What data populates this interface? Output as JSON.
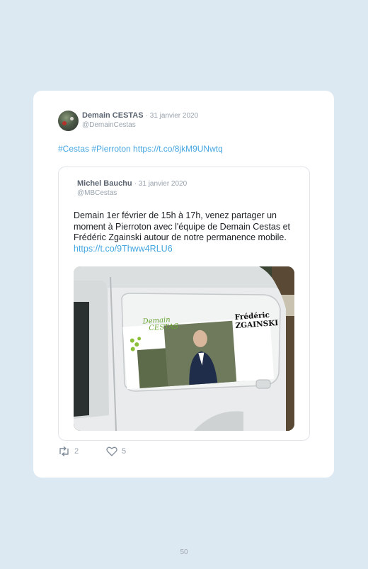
{
  "tweet": {
    "author_name": "Demain CESTAS",
    "date": "· 31 janvier 2020",
    "handle": "@DemainCestas",
    "text": "#Cestas #Pierroton https://t.co/8jkM9UNwtq"
  },
  "quoted": {
    "author_name": "Michel Bauchu",
    "date": "· 31 janvier 2020",
    "handle": "@MBCestas",
    "text": "Demain 1er février de 15h à 17h, venez partager un moment à Pierroton avec l'équipe de Demain Cestas et Frédéric Zgainski autour de notre permanence mobile.",
    "link": "https://t.co/9Thww4RLU6",
    "image_text": {
      "logo_line1": "Demain",
      "logo_line2": "CESTAS",
      "name_line1": "Frédéric",
      "name_line2": "ZGAINSKI"
    }
  },
  "actions": {
    "retweets": "2",
    "likes": "5"
  },
  "page_number": "50",
  "colors": {
    "background": "#dde9f2",
    "card": "#ffffff",
    "link": "#45a6e0",
    "muted": "#98a2ad"
  }
}
